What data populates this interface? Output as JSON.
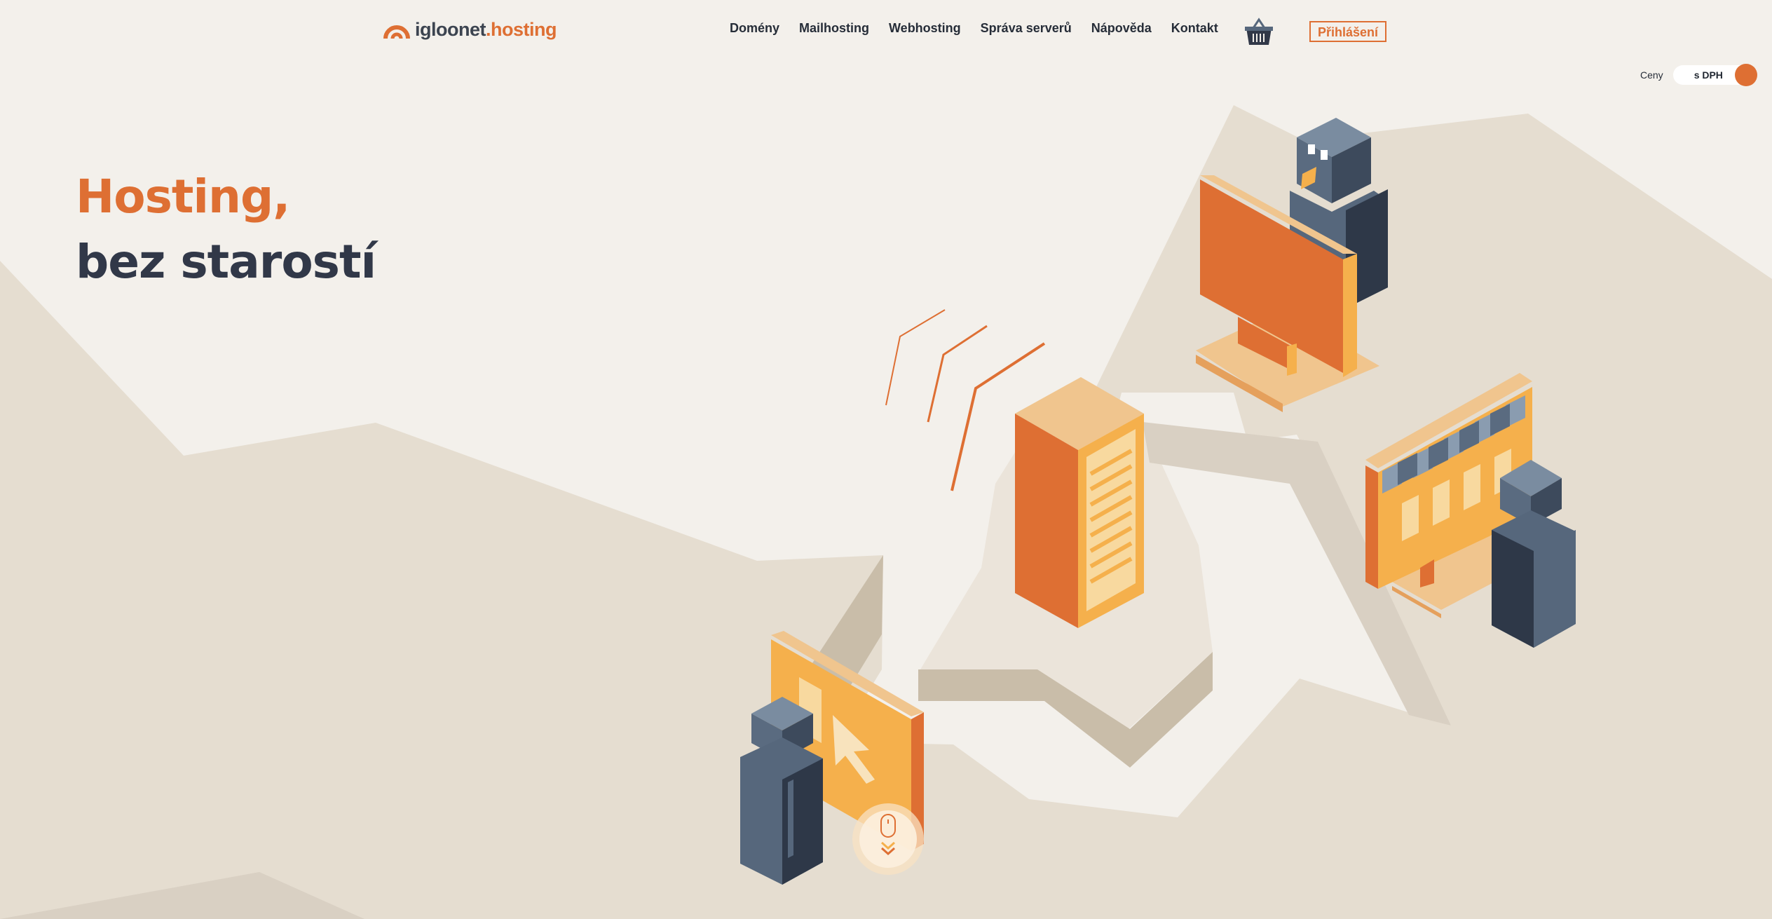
{
  "header": {
    "logo": {
      "brand": "igloonet",
      "tld": ".hosting"
    },
    "nav": [
      {
        "label": "Domény"
      },
      {
        "label": "Mailhosting"
      },
      {
        "label": "Webhosting"
      },
      {
        "label": "Správa serverů"
      },
      {
        "label": "Nápověda"
      },
      {
        "label": "Kontakt"
      }
    ],
    "login_label": "Přihlášení"
  },
  "prices": {
    "label": "Ceny",
    "toggle_value": "s DPH"
  },
  "hero": {
    "line1": "Hosting,",
    "line2": "bez starostí"
  },
  "colors": {
    "accent": "#de6f33",
    "dark": "#313848",
    "background": "#f3f0eb",
    "terrain": "#e5ddd0"
  }
}
